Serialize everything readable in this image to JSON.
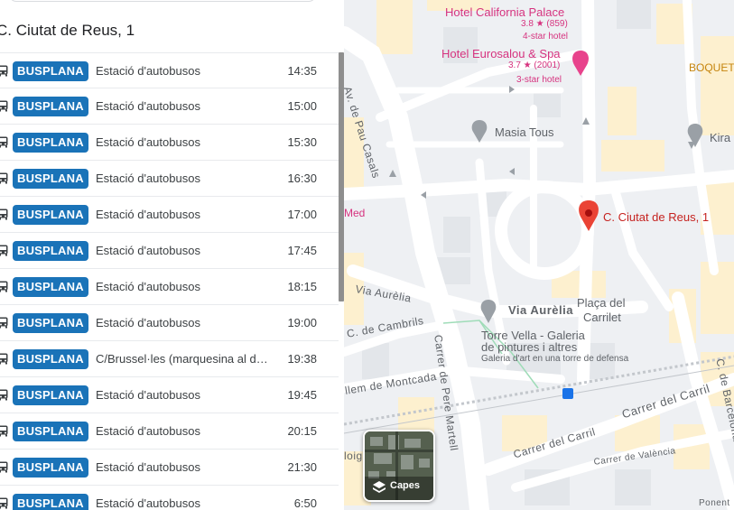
{
  "panel": {
    "title": "C. Ciutat de Reus, 1",
    "departures": [
      {
        "line": "BUSPLANA",
        "destination": "Estació d'autobusos",
        "time": "14:35"
      },
      {
        "line": "BUSPLANA",
        "destination": "Estació d'autobusos",
        "time": "15:00"
      },
      {
        "line": "BUSPLANA",
        "destination": "Estació d'autobusos",
        "time": "15:30"
      },
      {
        "line": "BUSPLANA",
        "destination": "Estació d'autobusos",
        "time": "16:30"
      },
      {
        "line": "BUSPLANA",
        "destination": "Estació d'autobusos",
        "time": "17:00"
      },
      {
        "line": "BUSPLANA",
        "destination": "Estació d'autobusos",
        "time": "17:45"
      },
      {
        "line": "BUSPLANA",
        "destination": "Estació d'autobusos",
        "time": "18:15"
      },
      {
        "line": "BUSPLANA",
        "destination": "Estació d'autobusos",
        "time": "19:00"
      },
      {
        "line": "BUSPLANA",
        "destination": "C/Brussel·les (marquesina al d…",
        "time": "19:38"
      },
      {
        "line": "BUSPLANA",
        "destination": "Estació d'autobusos",
        "time": "19:45"
      },
      {
        "line": "BUSPLANA",
        "destination": "Estació d'autobusos",
        "time": "20:15"
      },
      {
        "line": "BUSPLANA",
        "destination": "Estació d'autobusos",
        "time": "21:30"
      },
      {
        "line": "BUSPLANA",
        "destination": "Estació d'autobusos",
        "time": "6:50"
      }
    ],
    "badge_color": "#1a73b8"
  },
  "map": {
    "selected_place": "C. Ciutat de Reus, 1",
    "hotels": [
      {
        "name": "Hotel California Palace",
        "rating": "3.8 ★ (859)",
        "class": "4-star hotel"
      },
      {
        "name": "Hotel Eurosalou & Spa",
        "rating": "3.7 ★ (2001)",
        "class": "3-star hotel"
      }
    ],
    "poi_labels": {
      "masia": "Masia Tous",
      "kira": "Kira",
      "boquet": "BOQUET",
      "med": "Med",
      "torre_line1": "Torre Vella - Galeria",
      "torre_line2": "de pintures i altres",
      "torre_sub": "Galeria d'art en una torre de defensa",
      "placa_line1": "Plaça del",
      "placa_line2": "Carrilet"
    },
    "streets": {
      "pau_casals": "Av. de Pau Casals",
      "aurelia_main": "Via Aurèlia",
      "aurelia_diag": "Via Aurèlia",
      "cambrils": "C. de Cambrils",
      "montcada": "llem de Montcada",
      "pere_martell": "Carrer de Pere Martell",
      "carril_1": "Carrer del Carril",
      "carril_2": "Carrer del Carril",
      "barcelona": "C. de Barcelona",
      "valencia": "Carrer de València",
      "ponent": "Ponent",
      "loig": "loig"
    },
    "layers_label": "Capes",
    "colors": {
      "pink": "#d6337f",
      "pin_red": "#ea4335",
      "road": "#ffffff",
      "block": "#fdf1d0"
    }
  }
}
